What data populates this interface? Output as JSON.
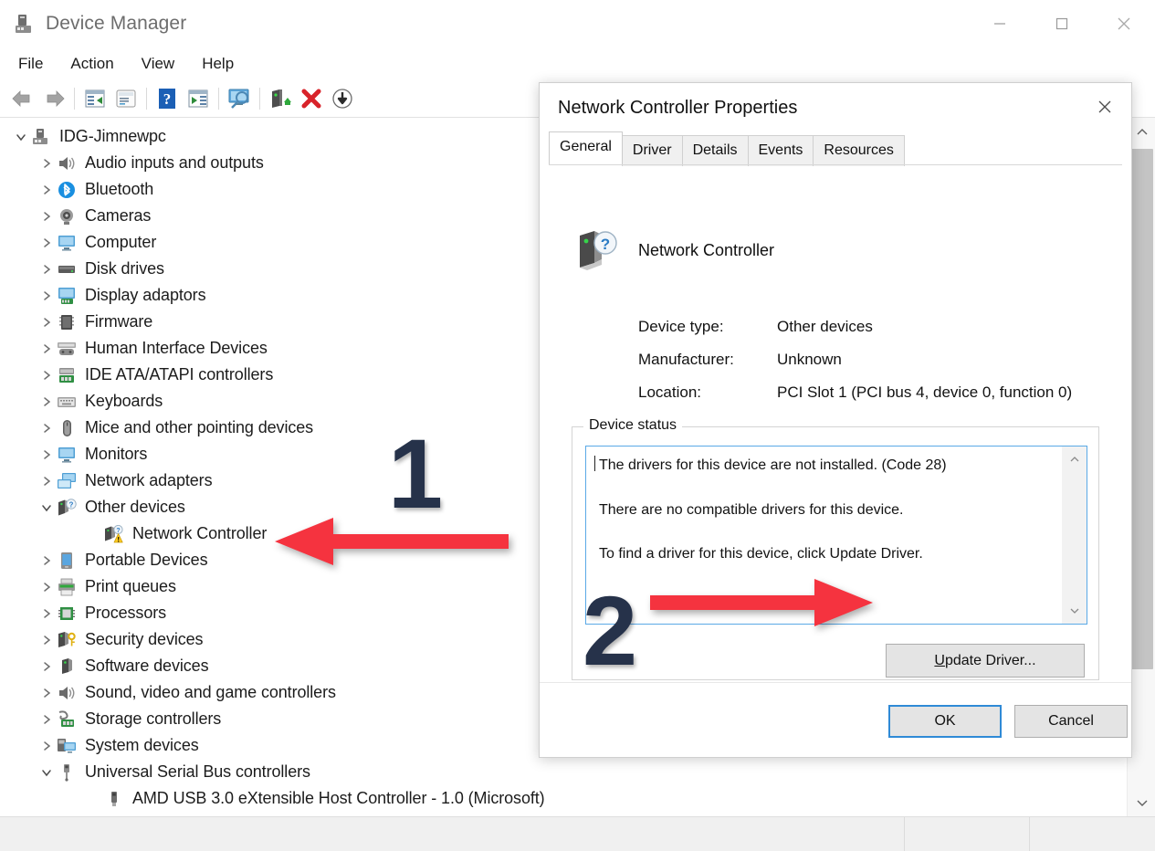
{
  "window": {
    "title": "Device Manager",
    "icon": "device-manager-icon",
    "controls": {
      "minimize": "minimize-icon",
      "maximize": "maximize-icon",
      "close": "close-icon"
    }
  },
  "menubar": {
    "items": [
      {
        "label": "File"
      },
      {
        "label": "Action"
      },
      {
        "label": "View"
      },
      {
        "label": "Help"
      }
    ]
  },
  "toolbar": {
    "buttons": [
      {
        "name": "back-icon"
      },
      {
        "name": "forward-icon"
      },
      {
        "name": "properties-icon"
      },
      {
        "name": "show-hidden-devices-icon"
      },
      {
        "name": "help-icon"
      },
      {
        "name": "update-driver-icon"
      },
      {
        "name": "scan-hardware-changes-icon"
      },
      {
        "name": "enable-device-icon"
      },
      {
        "name": "uninstall-device-icon"
      },
      {
        "name": "disable-device-icon"
      }
    ]
  },
  "tree": {
    "root": {
      "label": "IDG-Jimnewpc",
      "icon": "computer-root-icon",
      "expanded": true
    },
    "items": [
      {
        "label": "Audio inputs and outputs",
        "icon": "speaker-icon",
        "expandable": true,
        "expanded": false,
        "level": 1
      },
      {
        "label": "Bluetooth",
        "icon": "bluetooth-icon",
        "expandable": true,
        "expanded": false,
        "level": 1
      },
      {
        "label": "Cameras",
        "icon": "camera-icon",
        "expandable": true,
        "expanded": false,
        "level": 1
      },
      {
        "label": "Computer",
        "icon": "monitor-icon",
        "expandable": true,
        "expanded": false,
        "level": 1
      },
      {
        "label": "Disk drives",
        "icon": "disk-drive-icon",
        "expandable": true,
        "expanded": false,
        "level": 1
      },
      {
        "label": "Display adaptors",
        "icon": "display-adapter-icon",
        "expandable": true,
        "expanded": false,
        "level": 1
      },
      {
        "label": "Firmware",
        "icon": "firmware-chip-icon",
        "expandable": true,
        "expanded": false,
        "level": 1
      },
      {
        "label": "Human Interface Devices",
        "icon": "hid-icon",
        "expandable": true,
        "expanded": false,
        "level": 1
      },
      {
        "label": "IDE ATA/ATAPI controllers",
        "icon": "ide-controller-icon",
        "expandable": true,
        "expanded": false,
        "level": 1
      },
      {
        "label": "Keyboards",
        "icon": "keyboard-icon",
        "expandable": true,
        "expanded": false,
        "level": 1
      },
      {
        "label": "Mice and other pointing devices",
        "icon": "mouse-icon",
        "expandable": true,
        "expanded": false,
        "level": 1
      },
      {
        "label": "Monitors",
        "icon": "monitor-icon",
        "expandable": true,
        "expanded": false,
        "level": 1
      },
      {
        "label": "Network adapters",
        "icon": "network-adapter-icon",
        "expandable": true,
        "expanded": false,
        "level": 1
      },
      {
        "label": "Other devices",
        "icon": "other-devices-icon",
        "expandable": true,
        "expanded": true,
        "level": 1
      },
      {
        "label": "Network Controller",
        "icon": "unknown-device-warning-icon",
        "expandable": false,
        "level": 2
      },
      {
        "label": "Portable Devices",
        "icon": "portable-device-icon",
        "expandable": true,
        "expanded": false,
        "level": 1
      },
      {
        "label": "Print queues",
        "icon": "printer-icon",
        "expandable": true,
        "expanded": false,
        "level": 1
      },
      {
        "label": "Processors",
        "icon": "processor-icon",
        "expandable": true,
        "expanded": false,
        "level": 1
      },
      {
        "label": "Security devices",
        "icon": "security-device-icon",
        "expandable": true,
        "expanded": false,
        "level": 1
      },
      {
        "label": "Software devices",
        "icon": "software-device-icon",
        "expandable": true,
        "expanded": false,
        "level": 1
      },
      {
        "label": "Sound, video and game controllers",
        "icon": "speaker-icon",
        "expandable": true,
        "expanded": false,
        "level": 1
      },
      {
        "label": "Storage controllers",
        "icon": "storage-controller-icon",
        "expandable": true,
        "expanded": false,
        "level": 1
      },
      {
        "label": "System devices",
        "icon": "system-device-icon",
        "expandable": true,
        "expanded": false,
        "level": 1
      },
      {
        "label": "Universal Serial Bus controllers",
        "icon": "usb-icon",
        "expandable": true,
        "expanded": true,
        "level": 1
      },
      {
        "label": "AMD USB 3.0 eXtensible Host Controller - 1.0 (Microsoft)",
        "icon": "usb-device-icon",
        "expandable": false,
        "level": 2
      }
    ]
  },
  "dialog": {
    "title": "Network Controller Properties",
    "close_icon": "close-icon",
    "tabs": [
      {
        "label": "General",
        "active": true
      },
      {
        "label": "Driver",
        "active": false
      },
      {
        "label": "Details",
        "active": false
      },
      {
        "label": "Events",
        "active": false
      },
      {
        "label": "Resources",
        "active": false
      }
    ],
    "device": {
      "icon": "unknown-device-icon",
      "name": "Network Controller"
    },
    "info": [
      {
        "key": "Device type:",
        "value": "Other devices"
      },
      {
        "key": "Manufacturer:",
        "value": "Unknown"
      },
      {
        "key": "Location:",
        "value": "PCI Slot 1 (PCI bus 4, device 0, function 0)"
      }
    ],
    "status_group_label": "Device status",
    "status_lines": [
      "The drivers for this device are not installed. (Code 28)",
      "There are no compatible drivers for this device.",
      "To find a driver for this device, click Update Driver."
    ],
    "update_button": {
      "accel": "U",
      "rest": "pdate Driver..."
    },
    "footer": {
      "ok": "OK",
      "cancel": "Cancel"
    }
  },
  "annotations": [
    {
      "label": "1",
      "arrow": "left",
      "color": "#F5333F"
    },
    {
      "label": "2",
      "arrow": "right",
      "color": "#F5333F"
    }
  ],
  "colors": {
    "annotation_red": "#F5333F",
    "annotation_navy": "#26324A",
    "focus_blue": "#2F8AD6",
    "textbox_border_blue": "#5AA9E6"
  }
}
